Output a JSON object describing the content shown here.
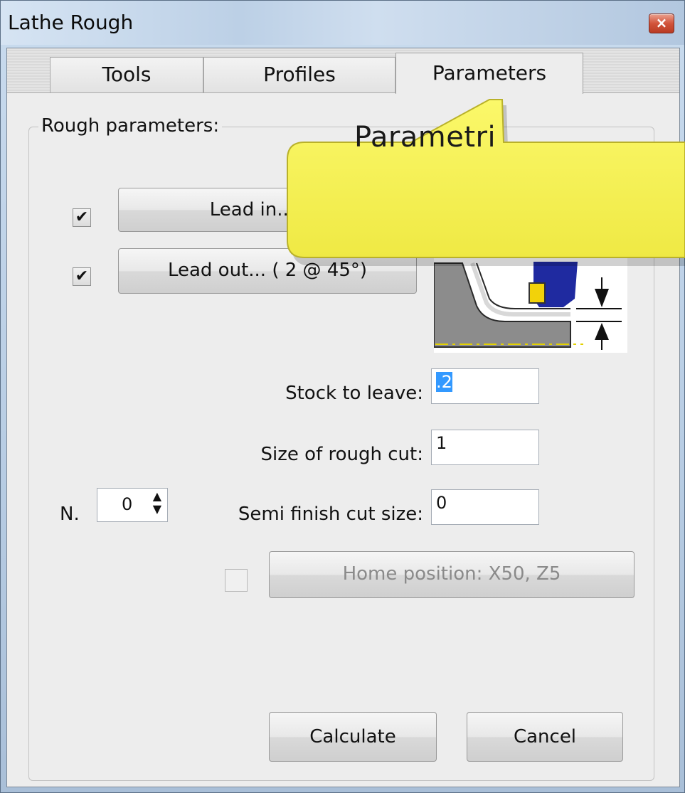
{
  "window": {
    "title": "Lathe Rough",
    "close_glyph": "×"
  },
  "tabs": [
    {
      "label": "Tools",
      "active": false
    },
    {
      "label": "Profiles",
      "active": false
    },
    {
      "label": "Parameters",
      "active": true
    }
  ],
  "group": {
    "label": "Rough parameters:"
  },
  "lead_in": {
    "checked": true,
    "label": "Lead in... ( 2"
  },
  "lead_out": {
    "checked": true,
    "label": "Lead out... ( 2 @ 45°)"
  },
  "fields": {
    "stock": {
      "label": "Stock to leave:",
      "value": ".2"
    },
    "rough_cut": {
      "label": "Size of rough cut:",
      "value": "1"
    },
    "semi_finish": {
      "label": "Semi finish cut size:",
      "value": "0"
    }
  },
  "passes": {
    "label": "N.",
    "value": "0"
  },
  "home": {
    "checked": false,
    "label": "Home position: X50, Z5",
    "enabled": false
  },
  "buttons": {
    "calculate": "Calculate",
    "cancel": "Cancel"
  },
  "callout": {
    "text": "Parametri",
    "color": "#f7f35a"
  },
  "icons": {
    "check": "✔",
    "spin_up": "▲",
    "spin_down": "▼"
  }
}
